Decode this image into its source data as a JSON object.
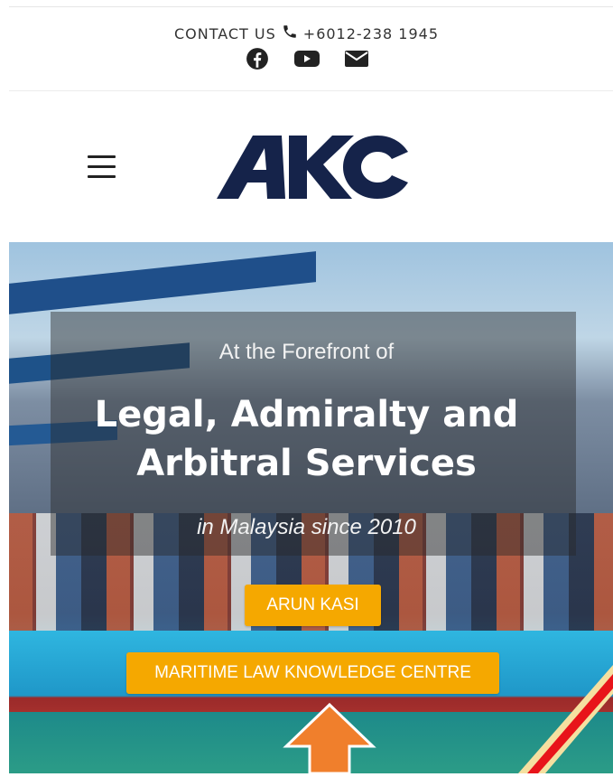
{
  "header": {
    "contact_label": "CONTACT US",
    "phone": "+6012-238 1945",
    "social_icons": [
      "facebook-icon",
      "youtube-icon",
      "email-icon"
    ]
  },
  "logo": {
    "text": "AKC",
    "color": "#15234a"
  },
  "hero": {
    "tagline": "At the Forefront of",
    "headline_line1": "Legal, Admiralty and",
    "headline_line2": "Arbitral Services",
    "since": "in Malaysia since 2010"
  },
  "buttons": {
    "arun": "ARUN KASI",
    "maritime": "MARITIME LAW KNOWLEDGE CENTRE",
    "color": "#f5a800"
  },
  "annotation": {
    "arrow_color": "#f07f2c",
    "ribbon_color": "#e8141a"
  }
}
